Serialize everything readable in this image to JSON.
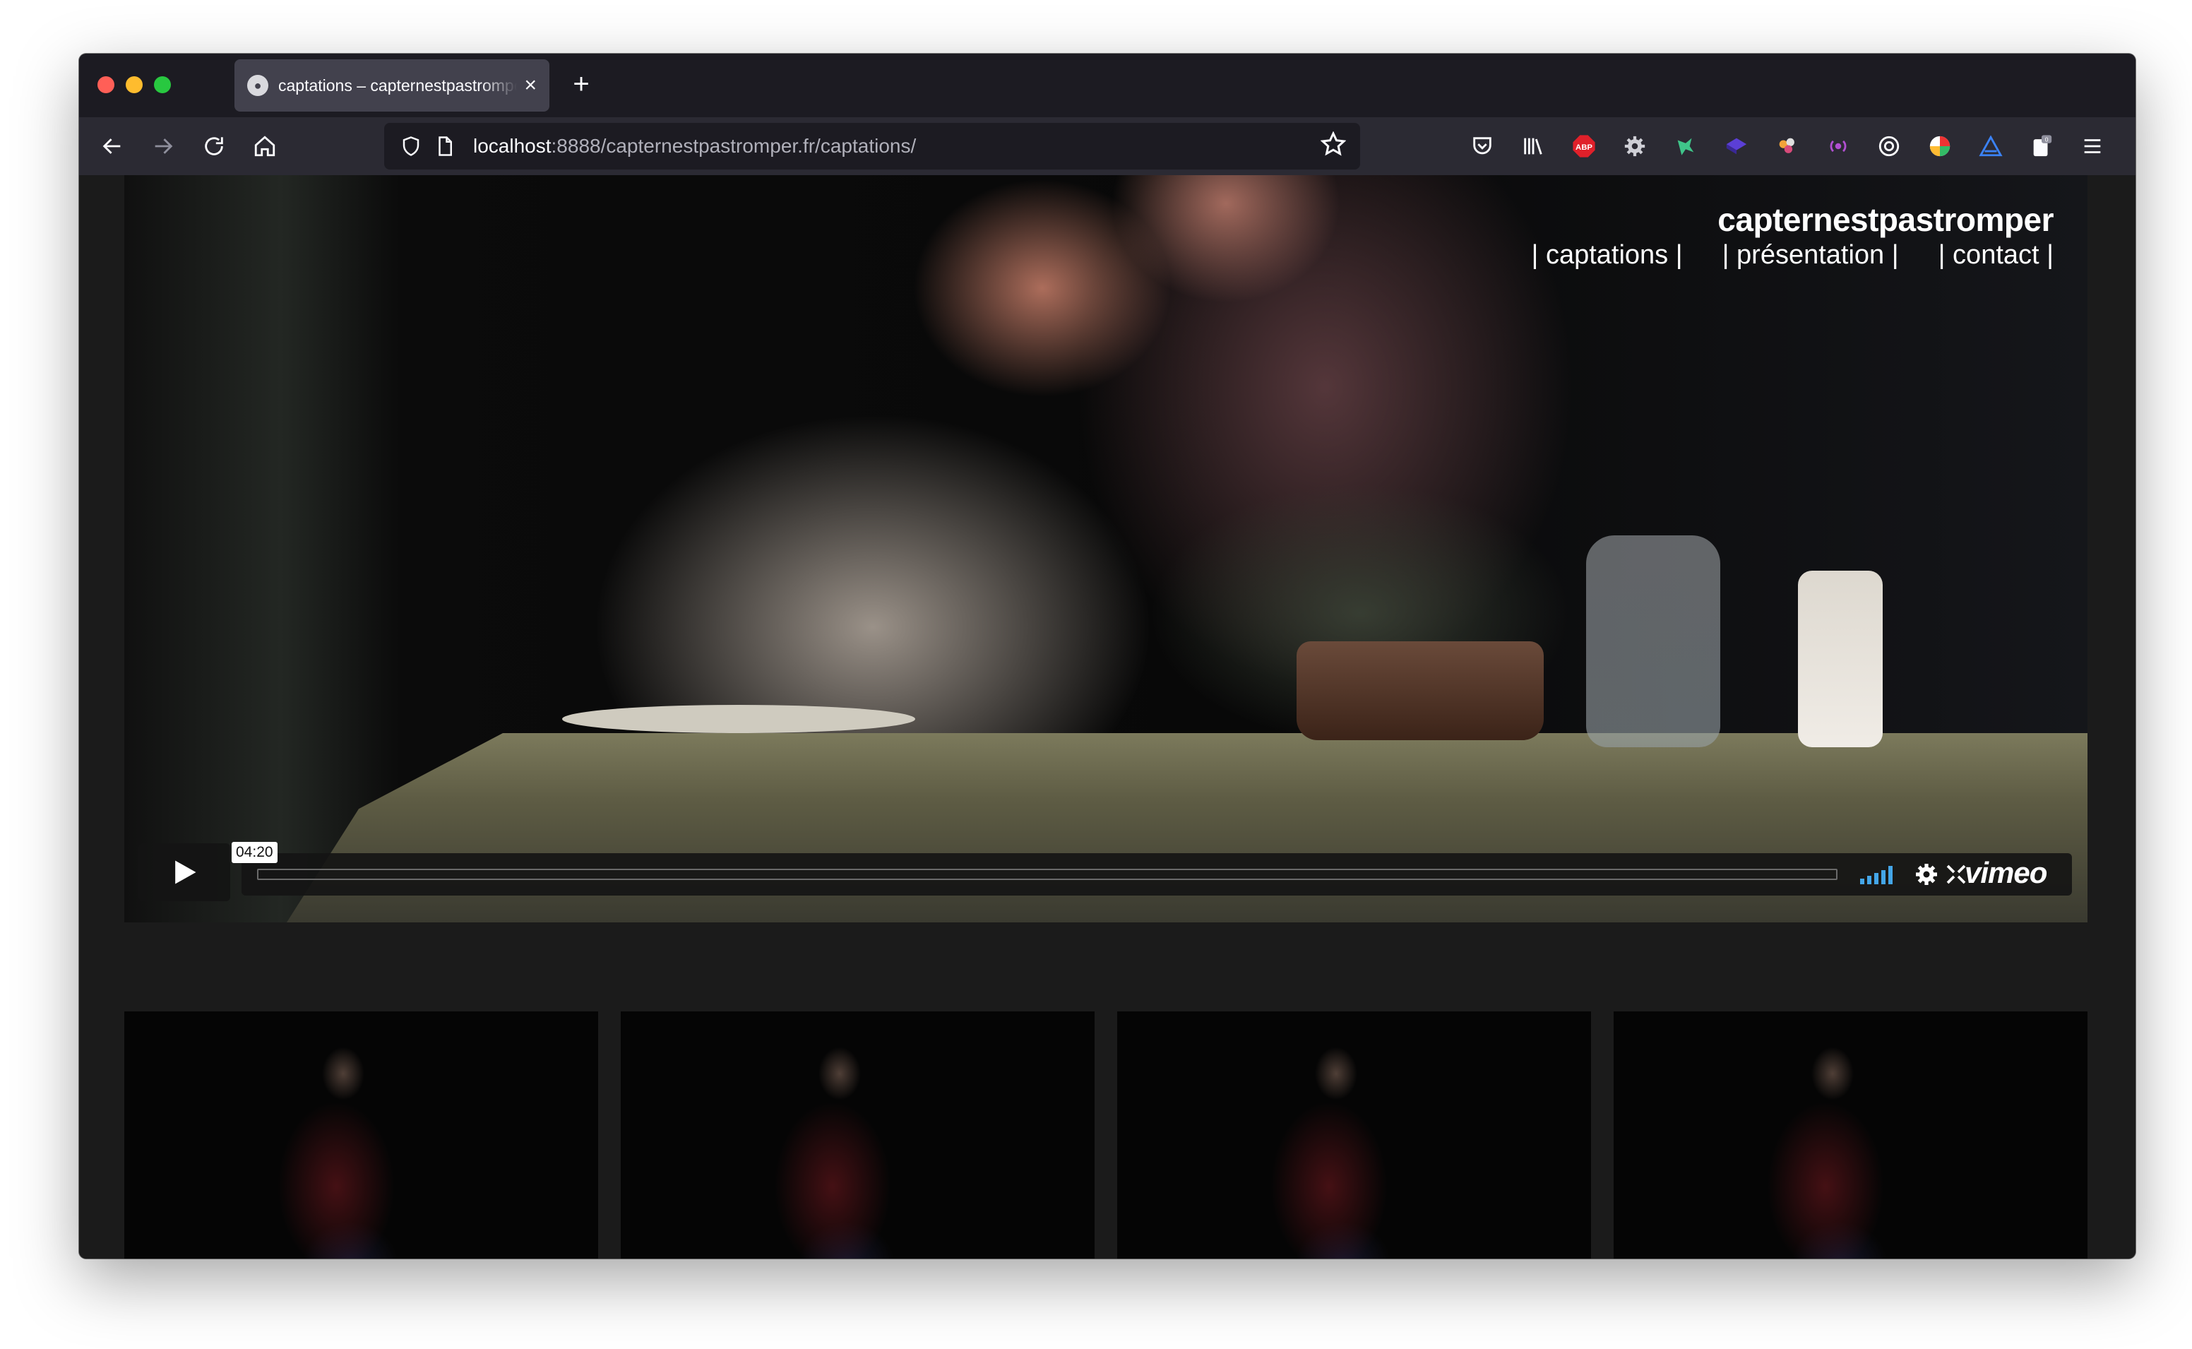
{
  "browser": {
    "tab": {
      "title": "captations – capternestpastromper.fr"
    },
    "url": {
      "host": "localhost",
      "rest": ":8888/capternestpastromper.fr/captations/"
    }
  },
  "site": {
    "brand": "capternestpastromper",
    "nav": [
      {
        "label": "| captations |"
      },
      {
        "label": "| présentation |"
      },
      {
        "label": "| contact |"
      }
    ]
  },
  "player": {
    "timecode": "04:20",
    "logo": "vimeo",
    "progress": 0
  },
  "thumbnails": 4,
  "icons": {
    "back": "back-arrow-icon",
    "forward": "forward-arrow-icon",
    "reload": "reload-icon",
    "home": "home-icon",
    "shield": "tracking-shield-icon",
    "page": "page-icon",
    "bookmark": "star-icon",
    "extensions": [
      "pocket-icon",
      "library-icon",
      "adblock-icon",
      "gear-extension-icon",
      "bird-extension-icon",
      "cube-extension-icon",
      "colors-extension-icon",
      "podcast-extension-icon",
      "privacy-extension-icon",
      "color-picker-icon",
      "warning-triangle-icon",
      "clipboard-icon",
      "menu-icon"
    ]
  },
  "colors": {
    "toolbar": "#2b2a33",
    "tabstrip": "#1c1b22",
    "page_bg": "#1b1b1b",
    "volume": "#44a6e8",
    "adblock": "#e0202a"
  }
}
